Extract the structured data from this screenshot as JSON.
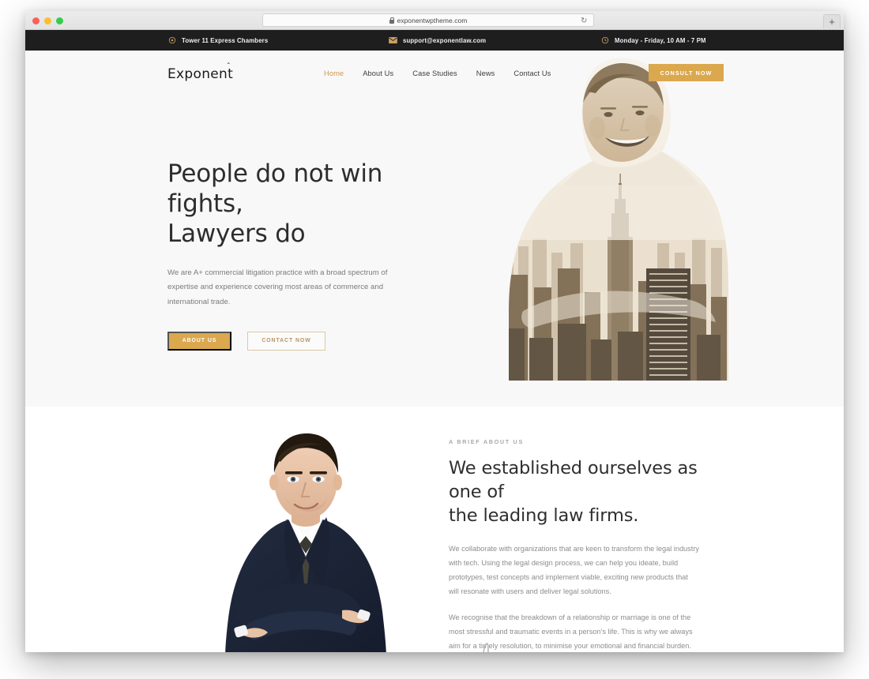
{
  "browser": {
    "url": "exponentwptheme.com",
    "lock_icon": "lock-icon",
    "reload_icon": "reload-icon",
    "newtab_label": "+"
  },
  "topbar": {
    "items": [
      {
        "icon": "location-pin-icon",
        "text": "Tower 11 Express Chambers"
      },
      {
        "icon": "envelope-icon",
        "text": "support@exponentlaw.com"
      },
      {
        "icon": "clock-icon",
        "text": "Monday - Friday, 10 AM - 7 PM"
      }
    ]
  },
  "header": {
    "logo": "Exponent",
    "nav": [
      {
        "label": "Home",
        "active": true
      },
      {
        "label": "About Us",
        "active": false
      },
      {
        "label": "Case Studies",
        "active": false
      },
      {
        "label": "News",
        "active": false
      },
      {
        "label": "Contact Us",
        "active": false
      }
    ],
    "cta_label": "CONSULT NOW"
  },
  "hero": {
    "heading_line1": "People do not win fights,",
    "heading_line2": "Lawyers do",
    "paragraph": "We are A+ commercial litigation practice with a broad spectrum of expertise and experience covering most areas of commerce and international trade.",
    "primary_button": "ABOUT US",
    "secondary_button": "CONTACT NOW",
    "image_alt": "double-exposure-portrait-cityscape"
  },
  "about": {
    "eyebrow": "A BRIEF ABOUT US",
    "heading_line1": "We established ourselves as one of",
    "heading_line2": "the leading law firms.",
    "paragraph1": "We collaborate with organizations that are keen to transform the legal industry with tech. Using the legal design process, we can help you ideate, build prototypes, test concepts and implement viable, exciting new products that will resonate with users and deliver legal solutions.",
    "paragraph2": "We recognise that the breakdown of a relationship or marriage is one of the most stressful and traumatic events in a person’s life. This is why we always aim for a timely resolution, to minimise your emotional and financial burden.",
    "image_alt": "lawyer-portrait-arms-crossed"
  },
  "colors": {
    "accent": "#dba84e",
    "accent_text": "#cf9a4f",
    "topbar_bg": "#1e1e1e",
    "hero_bg": "#f8f8f8",
    "body_text": "#8d8d8d"
  }
}
